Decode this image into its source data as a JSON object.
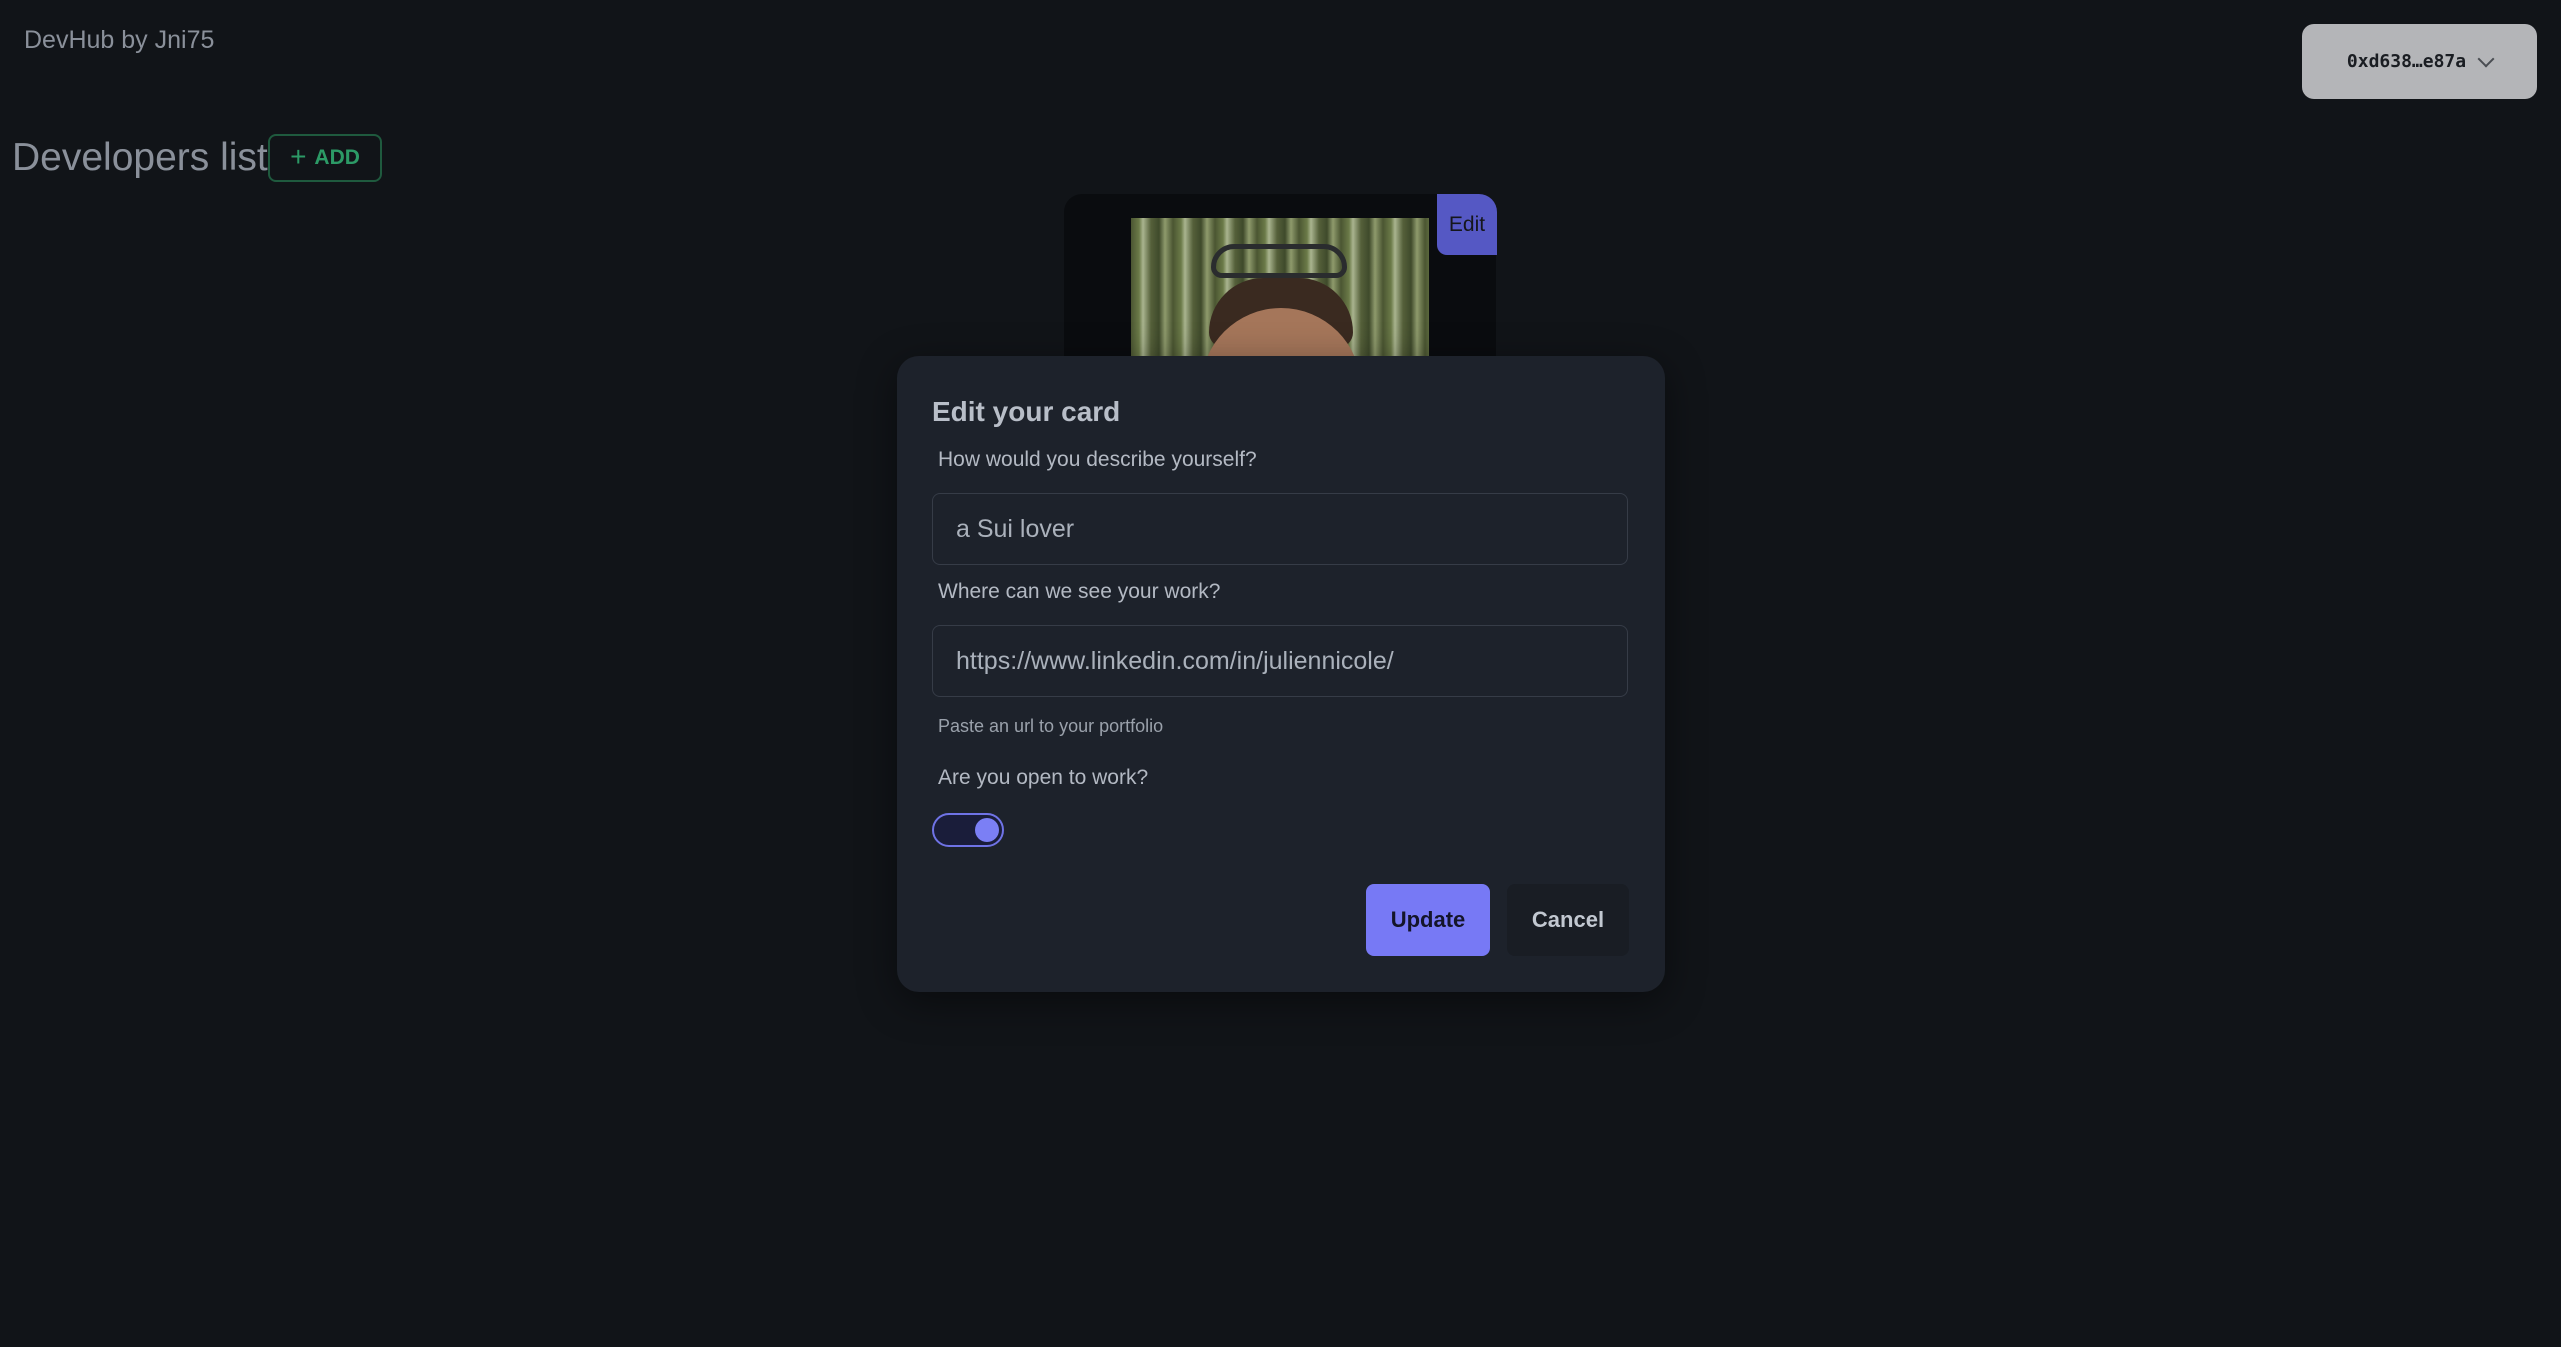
{
  "header": {
    "app_title": "DevHub by Jni75",
    "wallet_address": "0xd638…e87a"
  },
  "main": {
    "section_title": "Developers list",
    "add_button_label": "ADD",
    "card": {
      "edit_label": "Edit"
    }
  },
  "modal": {
    "title": "Edit your card",
    "describe_label": "How would you describe yourself?",
    "describe_value": "a Sui lover",
    "work_label": "Where can we see your work?",
    "work_value": "https://www.linkedin.com/in/juliennicole/",
    "work_helper": "Paste an url to your portfolio",
    "open_to_work_label": "Are you open to work?",
    "open_to_work": true,
    "update_label": "Update",
    "cancel_label": "Cancel"
  },
  "colors": {
    "accent": "#7779f5",
    "add_green": "#2c9a66",
    "background": "#111418",
    "modal_bg": "#1d222b"
  }
}
